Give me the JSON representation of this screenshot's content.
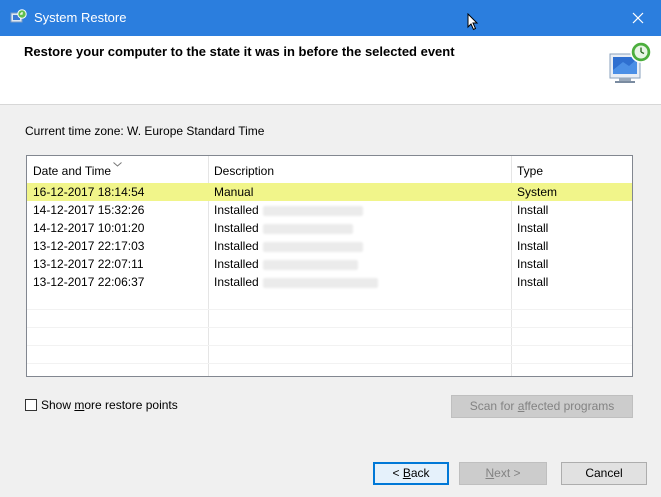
{
  "window": {
    "title": "System Restore"
  },
  "header": {
    "title": "Restore your computer to the state it was in before the selected event"
  },
  "timezone": {
    "label": "Current time zone: W. Europe Standard Time"
  },
  "table": {
    "columns": [
      "Date and Time",
      "Description",
      "Type"
    ],
    "rows": [
      {
        "date": "16-12-2017 18:14:54",
        "desc": "Manual",
        "type": "System",
        "selected": true
      },
      {
        "date": "14-12-2017 15:32:26",
        "desc": "Installed",
        "type": "Install"
      },
      {
        "date": "14-12-2017 10:01:20",
        "desc": "Installed",
        "type": "Install"
      },
      {
        "date": "13-12-2017 22:17:03",
        "desc": "Installed",
        "type": "Install"
      },
      {
        "date": "13-12-2017 22:07:11",
        "desc": "Installed",
        "type": "Install"
      },
      {
        "date": "13-12-2017 22:06:37",
        "desc": "Installed",
        "type": "Install"
      }
    ]
  },
  "options": {
    "show_more_pre": "Show ",
    "show_more_u": "m",
    "show_more_post": "ore restore points",
    "scan_pre": "Scan for ",
    "scan_u": "a",
    "scan_post": "ffected programs"
  },
  "buttons": {
    "back_pre": "< ",
    "back_u": "B",
    "back_post": "ack",
    "next_u": "N",
    "next_post": "ext >",
    "cancel": "Cancel"
  },
  "colors": {
    "titlebar": "#2b7ede",
    "selection": "#f1f58a",
    "accent": "#0078d7"
  }
}
